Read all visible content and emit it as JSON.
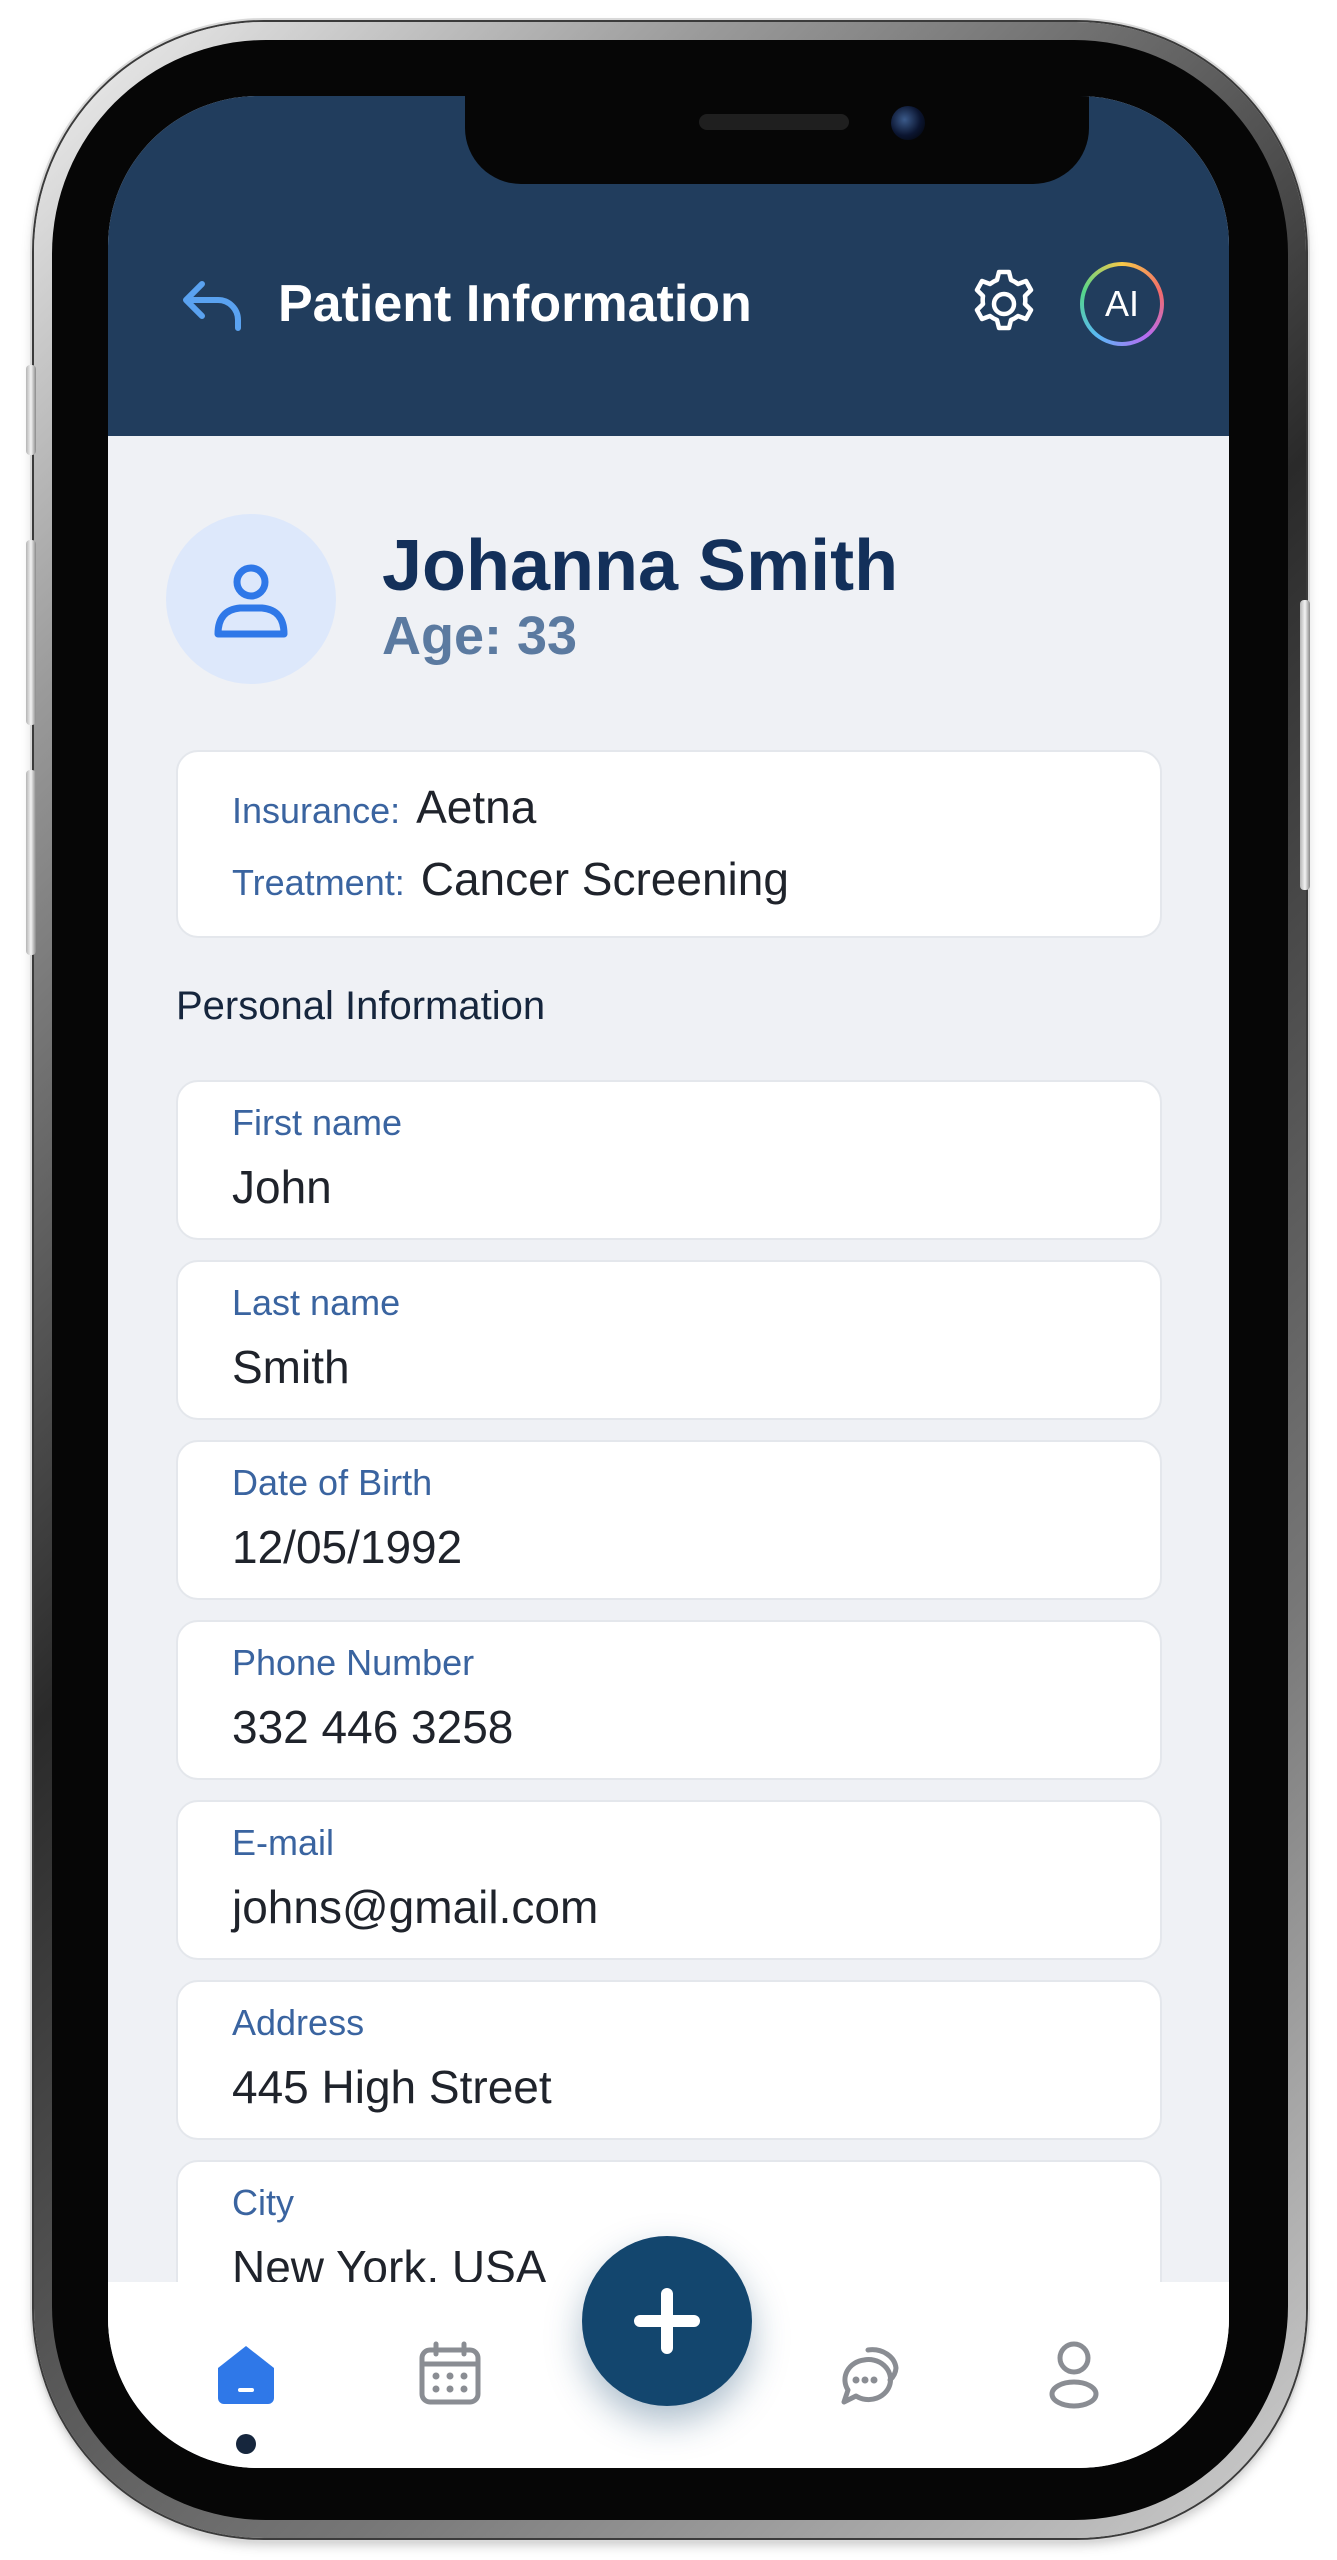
{
  "header": {
    "title": "Patient Information",
    "ai_label": "AI"
  },
  "patient": {
    "name": "Johanna Smith",
    "age_text": "Age: 33"
  },
  "summary": {
    "insurance_label": "Insurance:",
    "insurance_value": "Aetna",
    "treatment_label": "Treatment:",
    "treatment_value": "Cancer Screening"
  },
  "section": {
    "title": "Personal Information"
  },
  "fields": [
    {
      "label": "First name",
      "value": "John"
    },
    {
      "label": "Last name",
      "value": "Smith"
    },
    {
      "label": "Date of Birth",
      "value": "12/05/1992"
    },
    {
      "label": "Phone Number",
      "value": "332 446 3258"
    },
    {
      "label": "E-mail",
      "value": "johns@gmail.com"
    },
    {
      "label": "Address",
      "value": "445 High Street"
    },
    {
      "label": "City",
      "value": "New York, USA"
    }
  ],
  "nav": {
    "active": "home",
    "items": [
      "home-icon",
      "calendar-icon",
      "add-icon",
      "chat-icon",
      "profile-icon"
    ]
  },
  "colors": {
    "header_bg": "#213d5d",
    "accent": "#3a64a0",
    "fab": "#13466e",
    "active_nav": "#2f78e8"
  }
}
